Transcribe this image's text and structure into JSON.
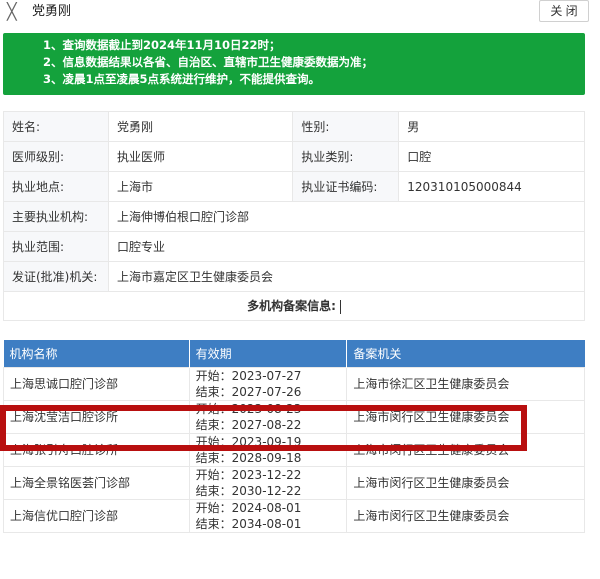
{
  "header": {
    "close_glyph": "╳",
    "title": "党勇刚",
    "close_button": "关 闭"
  },
  "notice": {
    "lines": [
      "1、查询数据截止到2024年11月10日22时；",
      "2、信息数据结果以各省、自治区、直辖市卫生健康委数据为准；",
      "3、凌晨1点至凌晨5点系统进行维护，不能提供查询。"
    ]
  },
  "info": {
    "name_label": "姓名:",
    "name_value": "党勇刚",
    "gender_label": "性别:",
    "gender_value": "男",
    "level_label": "医师级别:",
    "level_value": "执业医师",
    "category_label": "执业类别:",
    "category_value": "口腔",
    "location_label": "执业地点:",
    "location_value": "上海市",
    "cert_label": "执业证书编码:",
    "cert_value": "120310105000844",
    "org_label": "主要执业机构:",
    "org_value": "上海伸博伯根口腔门诊部",
    "scope_label": "执业范围:",
    "scope_value": "口腔专业",
    "issuer_label": "发证(批准)机关:",
    "issuer_value": "上海市嘉定区卫生健康委员会"
  },
  "multi_org_title": "多机构备案信息:",
  "org_table": {
    "columns": [
      "机构名称",
      "有效期",
      "备案机关"
    ],
    "rows": [
      {
        "name": "上海思诚口腔门诊部",
        "start": "开始：2023-07-27",
        "end": "结束：2027-07-26",
        "authority": "上海市徐汇区卫生健康委员会"
      },
      {
        "name": "上海沈莹洁口腔诊所",
        "start": "开始：2023-08-23",
        "end": "结束：2027-08-22",
        "authority": "上海市闵行区卫生健康委员会"
      },
      {
        "name": "上海张引舟口腔诊所",
        "start": "开始：2023-09-19",
        "end": "结束：2028-09-18",
        "authority": "上海市闵行区卫生健康委员会"
      },
      {
        "name": "上海全景铭医荟门诊部",
        "start": "开始：2023-12-22",
        "end": "结束：2030-12-22",
        "authority": "上海市闵行区卫生健康委员会"
      },
      {
        "name": "上海信优口腔门诊部",
        "start": "开始：2024-08-01",
        "end": "结束：2034-08-01",
        "authority": "上海市闵行区卫生健康委员会"
      }
    ]
  },
  "colors": {
    "notice_bg": "#14a23c",
    "table_header_bg": "#3e7ec3",
    "highlight_border": "#b80f0f"
  }
}
